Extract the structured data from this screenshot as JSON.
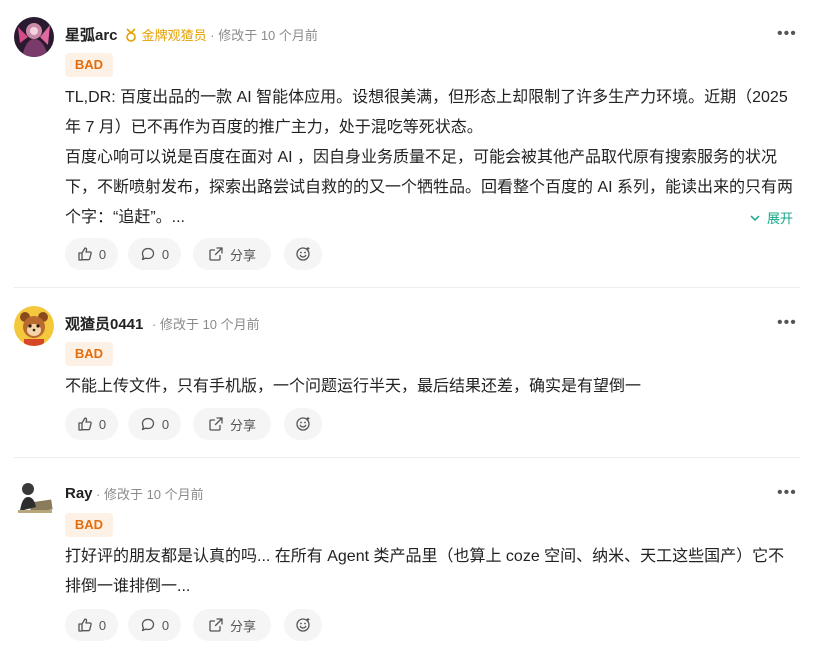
{
  "comments": [
    {
      "username": "星弧arc",
      "medal_label": "金牌观猹员",
      "time": "修改于 10 个月前",
      "badge": "BAD",
      "paragraphs": [
        "TL,DR: 百度出品的一款 AI 智能体应用。设想很美满，但形态上却限制了许多生产力环境。近期（2025 年 7 月）已不再作为百度的推广主力，处于混吃等死状态。",
        "百度心响可以说是百度在面对 AI ，因自身业务质量不足，可能会被其他产品取代原有搜索服务的状况下，不断喷射发布，探索出路尝试自救的的又一个牺牲品。回看整个百度的 AI 系列，能读出来的只有两个字：“追赶”。..."
      ],
      "expand_label": "展开",
      "likes": "0",
      "replies": "0",
      "share_label": "分享"
    },
    {
      "username": "观猹员0441",
      "time": "修改于 10 个月前",
      "badge": "BAD",
      "paragraphs": [
        "不能上传文件，只有手机版，一个问题运行半天，最后结果还差，确实是有望倒一"
      ],
      "likes": "0",
      "replies": "0",
      "share_label": "分享"
    },
    {
      "username": "Ray",
      "time": "修改于 10 个月前",
      "badge": "BAD",
      "paragraphs": [
        "打好评的朋友都是认真的吗... 在所有 Agent 类产品里（也算上 coze 空间、纳米、天工这些国产）它不排倒一谁排倒一..."
      ],
      "likes": "0",
      "replies": "0",
      "share_label": "分享"
    }
  ],
  "colors": {
    "badge_text": "#e46c0a",
    "badge_bg": "#fdf1e6",
    "expand": "#13a587",
    "medal": "#e5a000"
  },
  "icons": [
    "more-icon",
    "medal-icon",
    "thumb-up-icon",
    "comment-icon",
    "share-icon",
    "emoji-icon",
    "chevron-down-icon"
  ]
}
